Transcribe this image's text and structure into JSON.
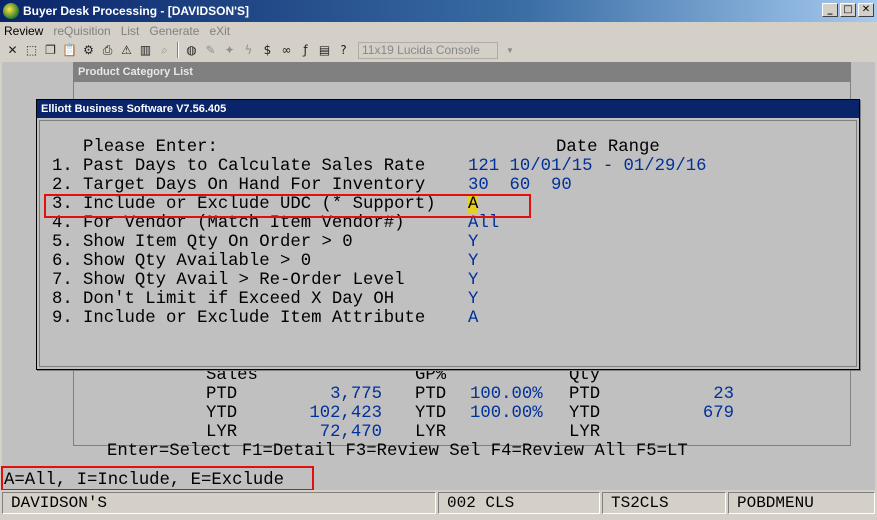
{
  "window": {
    "title": "Buyer Desk Processing - [DAVIDSON'S]",
    "minimize": "_",
    "maximize": "□",
    "close": "✕"
  },
  "menu": {
    "items": [
      "Review",
      "reQuisition",
      "List",
      "Generate",
      "eXit"
    ]
  },
  "toolbar": {
    "font_select": "11x19 Lucida Console",
    "font_dropdown": "▼"
  },
  "bg_window": {
    "title": "Product Category List",
    "sales_header": "Sales",
    "gp_header": "GP%",
    "qty_header": "Qty",
    "rows": [
      {
        "label": "PTD",
        "sales": "3,775",
        "gp_label": "PTD",
        "gp": "100.00%",
        "qty_label": "PTD",
        "qty": "23"
      },
      {
        "label": "YTD",
        "sales": "102,423",
        "gp_label": "YTD",
        "gp": "100.00%",
        "qty_label": "YTD",
        "qty": "679"
      },
      {
        "label": "LYR",
        "sales": "72,470",
        "gp_label": "LYR",
        "gp": "",
        "qty_label": "LYR",
        "qty": ""
      }
    ],
    "function_keys": "Enter=Select F1=Detail F3=Review Sel F4=Review All F5=LT"
  },
  "dialog": {
    "title": "Elliott Business Software V7.56.405",
    "prompt": "Please Enter:",
    "date_range_label": "Date Range",
    "options": [
      {
        "num": "1.",
        "label": "Past Days to Calculate Sales Rate",
        "value": "121 10/01/15 - 01/29/16"
      },
      {
        "num": "2.",
        "label": "Target Days On Hand For Inventory",
        "value": "30  60  90"
      },
      {
        "num": "3.",
        "label": "Include or Exclude UDC (* Support)",
        "value": "A"
      },
      {
        "num": "4.",
        "label": "For Vendor (Match Item Vendor#)",
        "value": "All"
      },
      {
        "num": "5.",
        "label": "Show Item Qty On Order > 0",
        "value": "Y"
      },
      {
        "num": "6.",
        "label": "Show Qty Available > 0",
        "value": "Y"
      },
      {
        "num": "7.",
        "label": "Show Qty Avail > Re-Order Level",
        "value": "Y"
      },
      {
        "num": "8.",
        "label": "Don't Limit if Exceed X Day OH",
        "value": "Y"
      },
      {
        "num": "9.",
        "label": "Include or Exclude Item Attribute",
        "value": "A"
      }
    ]
  },
  "help_line": "A=All, I=Include, E=Exclude",
  "status": {
    "company": "DAVIDSON'S",
    "code": "002 CLS",
    "terminal": "TS2CLS",
    "menu": "POBDMENU"
  }
}
